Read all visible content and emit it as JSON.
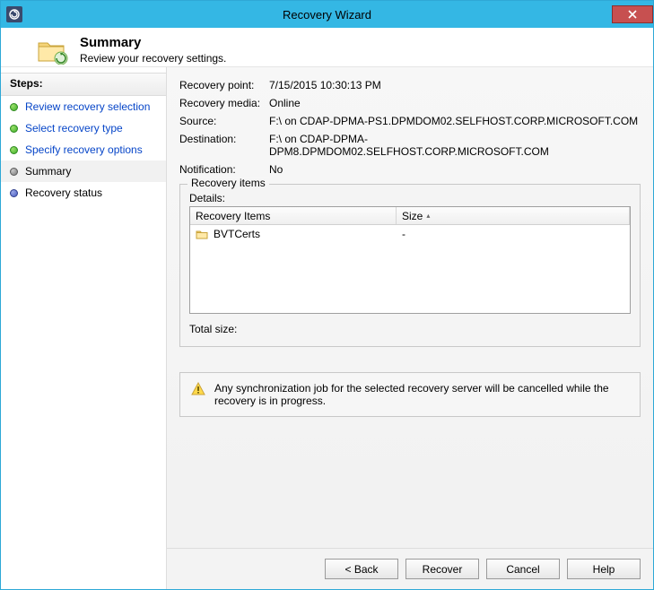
{
  "window": {
    "title": "Recovery Wizard"
  },
  "header": {
    "title": "Summary",
    "subtitle": "Review your recovery settings."
  },
  "sidebar": {
    "title": "Steps:",
    "steps": [
      {
        "label": "Review recovery selection",
        "state": "done"
      },
      {
        "label": "Select recovery type",
        "state": "done"
      },
      {
        "label": "Specify recovery options",
        "state": "done"
      },
      {
        "label": "Summary",
        "state": "current"
      },
      {
        "label": "Recovery status",
        "state": "pending"
      }
    ]
  },
  "info": {
    "recovery_point_label": "Recovery point:",
    "recovery_point": "7/15/2015 10:30:13 PM",
    "recovery_media_label": "Recovery media:",
    "recovery_media": "Online",
    "source_label": "Source:",
    "source": "F:\\ on CDAP-DPMA-PS1.DPMDOM02.SELFHOST.CORP.MICROSOFT.COM",
    "destination_label": "Destination:",
    "destination": "F:\\ on CDAP-DPMA-DPM8.DPMDOM02.SELFHOST.CORP.MICROSOFT.COM",
    "notification_label": "Notification:",
    "notification": "No"
  },
  "recovery_items": {
    "group_label": "Recovery items",
    "details_label": "Details:",
    "columns": {
      "c1": "Recovery Items",
      "c2": "Size"
    },
    "rows": [
      {
        "name": "BVTCerts",
        "size": "-"
      }
    ],
    "total_size_label": "Total size:",
    "total_size_value": ""
  },
  "warning": "Any synchronization job for the selected recovery server will be cancelled while the recovery is in progress.",
  "buttons": {
    "back": "< Back",
    "recover": "Recover",
    "cancel": "Cancel",
    "help": "Help"
  }
}
